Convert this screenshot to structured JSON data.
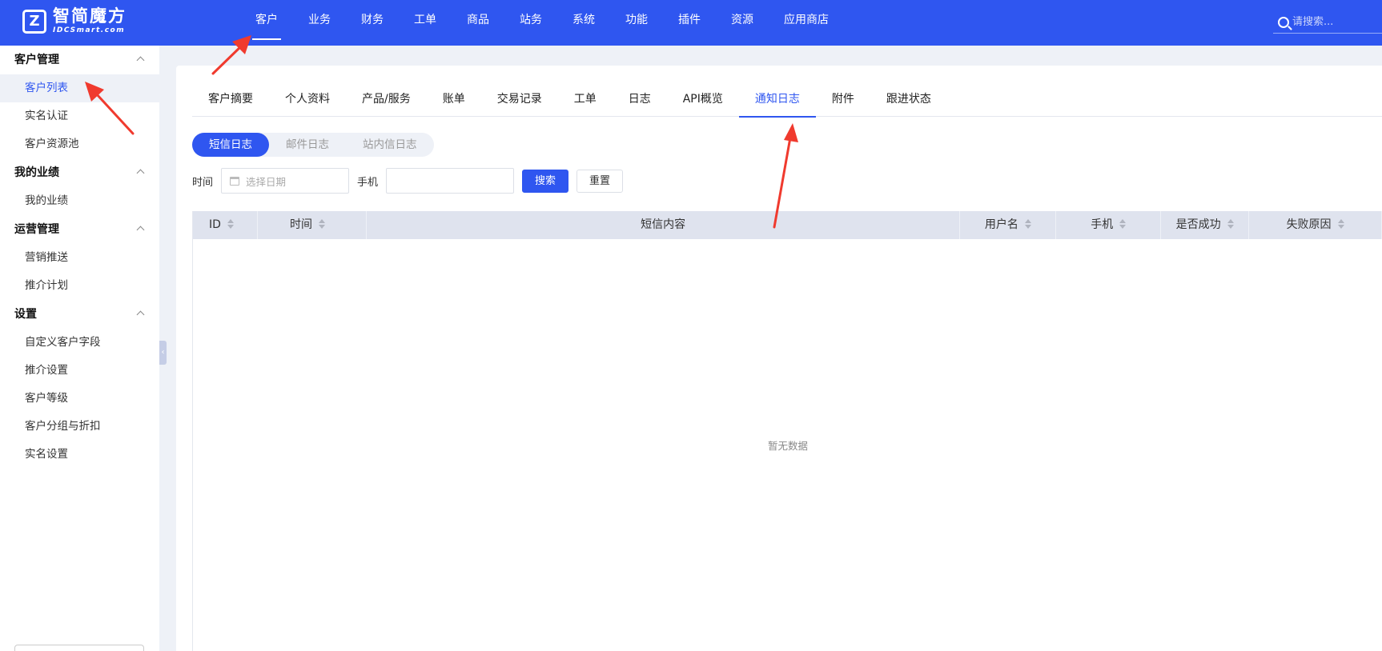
{
  "brand": {
    "name_cn": "智简魔方",
    "name_en": "IDCSmart.com",
    "mark": "Z"
  },
  "topnav": {
    "items": [
      {
        "label": "客户",
        "active": true
      },
      {
        "label": "业务"
      },
      {
        "label": "财务"
      },
      {
        "label": "工单"
      },
      {
        "label": "商品"
      },
      {
        "label": "站务"
      },
      {
        "label": "系统"
      },
      {
        "label": "功能"
      },
      {
        "label": "插件"
      },
      {
        "label": "资源"
      },
      {
        "label": "应用商店"
      }
    ],
    "search_placeholder": "请搜索..."
  },
  "sidebar": {
    "groups": [
      {
        "title": "客户管理",
        "items": [
          "客户列表",
          "实名认证",
          "客户资源池"
        ]
      },
      {
        "title": "我的业绩",
        "items": [
          "我的业绩"
        ]
      },
      {
        "title": "运营管理",
        "items": [
          "营销推送",
          "推介计划"
        ]
      },
      {
        "title": "设置",
        "items": [
          "自定义客户字段",
          "推介设置",
          "客户等级",
          "客户分组与折扣",
          "实名设置"
        ]
      }
    ],
    "active_item": "客户列表"
  },
  "tabs": {
    "items": [
      "客户摘要",
      "个人资料",
      "产品/服务",
      "账单",
      "交易记录",
      "工单",
      "日志",
      "API概览",
      "通知日志",
      "附件",
      "跟进状态"
    ],
    "active": "通知日志"
  },
  "log_types": {
    "items": [
      "短信日志",
      "邮件日志",
      "站内信日志"
    ],
    "active": "短信日志"
  },
  "filters": {
    "time_label": "时间",
    "date_placeholder": "选择日期",
    "phone_label": "手机",
    "phone_value": "",
    "search_button": "搜索",
    "reset_button": "重置"
  },
  "table": {
    "columns": [
      {
        "label": "ID",
        "sortable": true
      },
      {
        "label": "时间",
        "sortable": true
      },
      {
        "label": "短信内容",
        "sortable": false
      },
      {
        "label": "用户名",
        "sortable": true
      },
      {
        "label": "手机",
        "sortable": true
      },
      {
        "label": "是否成功",
        "sortable": true
      },
      {
        "label": "失败原因",
        "sortable": true
      }
    ],
    "rows": [],
    "empty_text": "暂无数据"
  },
  "colors": {
    "primary": "#2f56f0",
    "annotation": "#f03a2e",
    "background": "#eef1f7"
  }
}
